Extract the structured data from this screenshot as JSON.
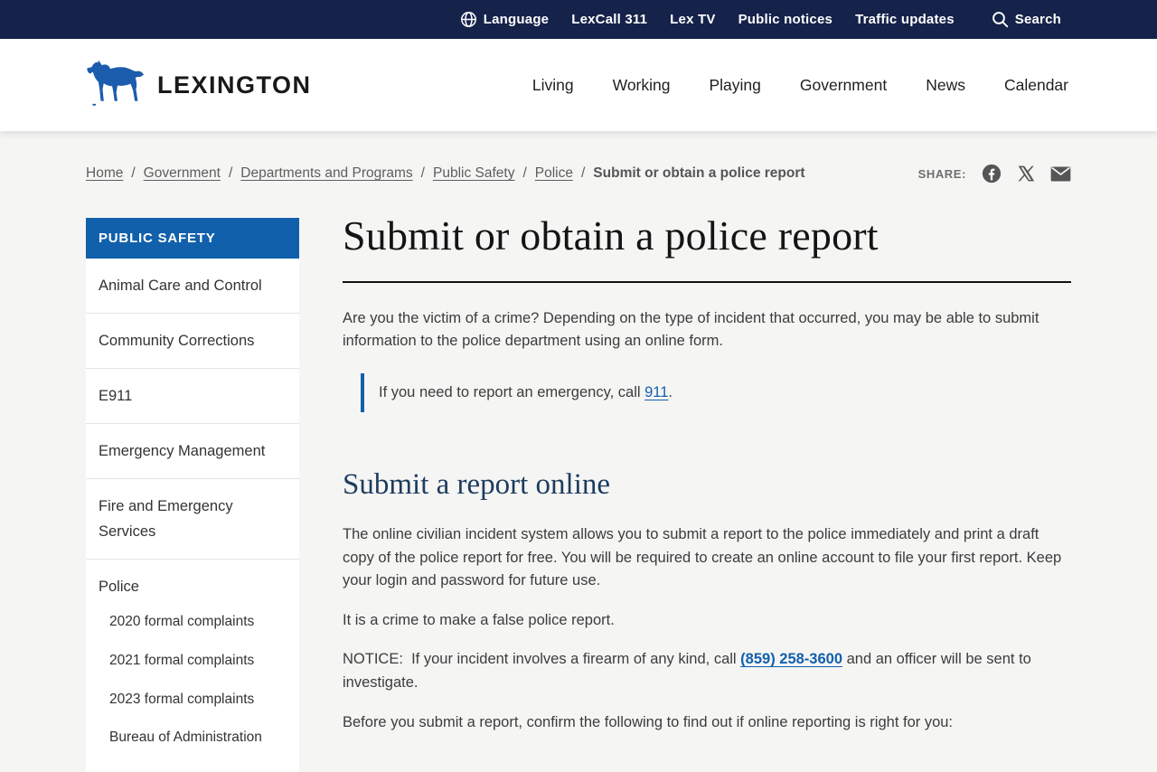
{
  "colors": {
    "navy_bar": "#15224a",
    "accent_blue": "#1160ac",
    "heading_navy": "#1d3c5e",
    "logo_blue": "#1b5cad"
  },
  "utility_bar": {
    "items": [
      {
        "label": "Language",
        "icon": "globe-icon"
      },
      {
        "label": "LexCall 311"
      },
      {
        "label": "Lex TV"
      },
      {
        "label": "Public notices"
      },
      {
        "label": "Traffic updates"
      }
    ],
    "search_label": "Search"
  },
  "header": {
    "brand": "LEXINGTON",
    "nav": [
      {
        "label": "Living"
      },
      {
        "label": "Working"
      },
      {
        "label": "Playing"
      },
      {
        "label": "Government"
      },
      {
        "label": "News"
      },
      {
        "label": "Calendar"
      }
    ]
  },
  "breadcrumb": {
    "links": [
      {
        "label": "Home"
      },
      {
        "label": "Government"
      },
      {
        "label": "Departments and Programs"
      },
      {
        "label": "Public Safety"
      },
      {
        "label": "Police"
      }
    ],
    "separator": "/",
    "current": "Submit or obtain a police report",
    "share_label": "SHARE:"
  },
  "sidebar": {
    "title": "PUBLIC SAFETY",
    "items": [
      {
        "label": "Animal Care and Control"
      },
      {
        "label": "Community Corrections"
      },
      {
        "label": "E911"
      },
      {
        "label": "Emergency Management"
      },
      {
        "label": "Fire and Emergency Services"
      },
      {
        "label": "Police"
      }
    ],
    "police_subitems": [
      {
        "label": "2020 formal complaints"
      },
      {
        "label": "2021 formal complaints"
      },
      {
        "label": "2023 formal complaints"
      },
      {
        "label": "Bureau of Administration"
      }
    ]
  },
  "content": {
    "title": "Submit or obtain a police report",
    "intro": "Are you the victim of a crime? Depending on the type of incident that occurred, you may be able to submit information to the police department using an online form.",
    "emergency": {
      "prefix": "If you need to report an emergency, call ",
      "link": "911",
      "suffix": "."
    },
    "section": {
      "heading": "Submit a report online",
      "p1": "The online civilian incident system allows you to submit a report to the police immediately and print a draft copy of the police report for free. You will be required to create an online account to file your first report. Keep your login and password for future use.",
      "p2": "It is a crime to make a false police report.",
      "notice_prefix": "NOTICE:  If your incident involves a firearm of any kind, call ",
      "notice_link": "(859) 258-3600",
      "notice_suffix": " and an officer will be sent to investigate.",
      "p3": "Before you submit a report, confirm the following to find out if online reporting is right for you:"
    }
  }
}
